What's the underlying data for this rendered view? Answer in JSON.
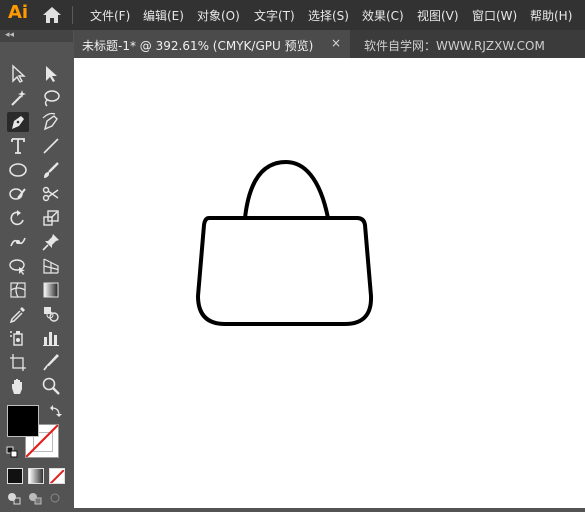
{
  "app": {
    "logo": "Ai"
  },
  "menu": [
    "文件(F)",
    "编辑(E)",
    "对象(O)",
    "文字(T)",
    "选择(S)",
    "效果(C)",
    "视图(V)",
    "窗口(W)",
    "帮助(H)"
  ],
  "document_tab": {
    "label": "未标题-1* @ 392.61% (CMYK/GPU 预览)",
    "close": "×"
  },
  "watermark": "软件自学网：WWW.RJZXW.COM",
  "toolbar": {
    "collapse": "◂◂",
    "tools": [
      "selection-tool",
      "direct-selection-tool",
      "magic-wand-tool",
      "lasso-tool",
      "pen-tool",
      "curvature-tool",
      "type-tool",
      "line-segment-tool",
      "ellipse-tool",
      "paintbrush-tool",
      "shaper-tool",
      "scissors-tool",
      "rotate-tool",
      "scale-tool",
      "puppet-warp-tool",
      "pin-tool",
      "free-transform-tool",
      "perspective-grid-tool",
      "mesh-tool",
      "gradient-tool",
      "eyedropper-tool",
      "blend-tool",
      "symbol-sprayer-tool",
      "column-graph-tool",
      "artboard-tool",
      "knife-tool",
      "hand-tool",
      "zoom-tool"
    ],
    "active_tool": "pen-tool",
    "fill_color": "#000000",
    "stroke_color": "none"
  },
  "colors": {
    "menubar": "#323232",
    "panel": "#535353",
    "canvas": "#ffffff",
    "logo": "#ff9a00"
  }
}
